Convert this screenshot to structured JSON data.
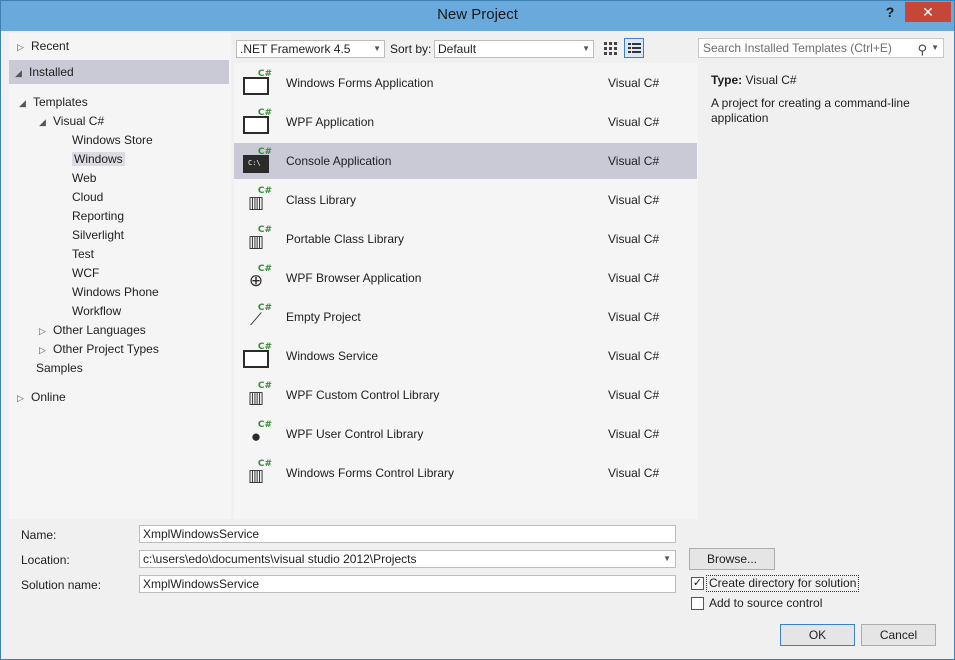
{
  "window": {
    "title": "New Project",
    "help": "?",
    "close": "✕"
  },
  "tree": {
    "recent": "Recent",
    "installed": "Installed",
    "templates": "Templates",
    "visual_csharp": "Visual C#",
    "children": [
      "Windows Store",
      "Windows",
      "Web",
      "Cloud",
      "Reporting",
      "Silverlight",
      "Test",
      "WCF",
      "Windows Phone",
      "Workflow"
    ],
    "other_languages": "Other Languages",
    "other_project_types": "Other Project Types",
    "samples": "Samples",
    "online": "Online",
    "selected_child": "Windows"
  },
  "toolbar": {
    "framework": ".NET Framework 4.5",
    "sort_label": "Sort by:",
    "sort_value": "Default",
    "search_placeholder": "Search Installed Templates (Ctrl+E)"
  },
  "templates": [
    {
      "name": "Windows Forms Application",
      "lang": "Visual C#",
      "icon": "windows-forms-icon"
    },
    {
      "name": "WPF Application",
      "lang": "Visual C#",
      "icon": "wpf-icon"
    },
    {
      "name": "Console Application",
      "lang": "Visual C#",
      "icon": "console-icon"
    },
    {
      "name": "Class Library",
      "lang": "Visual C#",
      "icon": "class-library-icon"
    },
    {
      "name": "Portable Class Library",
      "lang": "Visual C#",
      "icon": "portable-library-icon"
    },
    {
      "name": "WPF Browser Application",
      "lang": "Visual C#",
      "icon": "globe-icon"
    },
    {
      "name": "Empty Project",
      "lang": "Visual C#",
      "icon": "empty-project-icon"
    },
    {
      "name": "Windows Service",
      "lang": "Visual C#",
      "icon": "service-icon"
    },
    {
      "name": "WPF Custom Control Library",
      "lang": "Visual C#",
      "icon": "custom-control-icon"
    },
    {
      "name": "WPF User Control Library",
      "lang": "Visual C#",
      "icon": "user-control-icon"
    },
    {
      "name": "Windows Forms Control Library",
      "lang": "Visual C#",
      "icon": "forms-control-icon"
    }
  ],
  "selected_template": "Console Application",
  "description": {
    "type_label": "Type:",
    "type_value": "Visual C#",
    "text": "A project for creating a command-line application"
  },
  "form": {
    "name_label": "Name:",
    "name_value": "XmplWindowsService",
    "location_label": "Location:",
    "location_value": "c:\\users\\edo\\documents\\visual studio 2012\\Projects",
    "solution_label": "Solution name:",
    "solution_value": "XmplWindowsService",
    "browse_label": "Browse...",
    "create_dir_label": "Create directory for solution",
    "create_dir_checked": true,
    "source_control_label": "Add to source control",
    "source_control_checked": false,
    "ok_label": "OK",
    "cancel_label": "Cancel"
  }
}
